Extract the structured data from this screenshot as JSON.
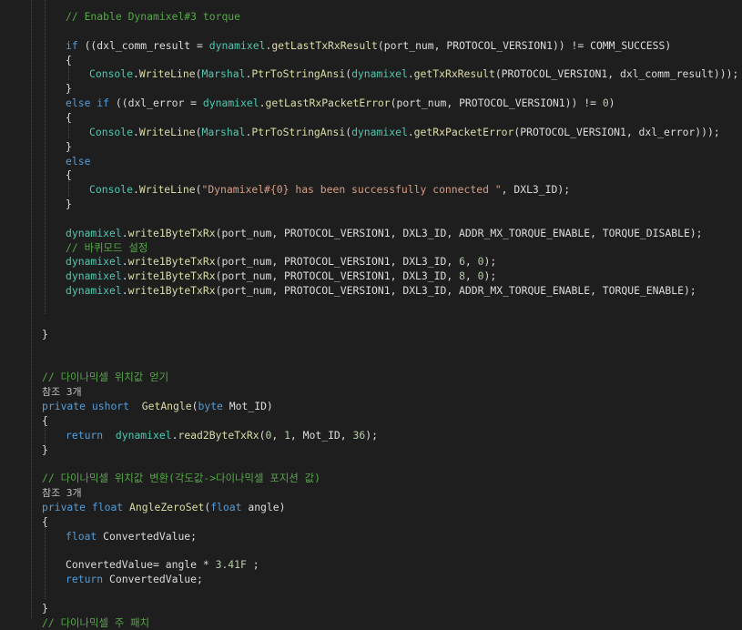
{
  "lines": [
    {
      "indent": 3,
      "tokens": [
        {
          "t": "// Enable Dynamixel#3 torque",
          "c": "comment"
        }
      ]
    },
    {
      "indent": 0,
      "tokens": []
    },
    {
      "indent": 3,
      "tokens": [
        {
          "t": "if",
          "c": "keyword"
        },
        {
          "t": " ((dxl_comm_result = ",
          "c": "plain"
        },
        {
          "t": "dynamixel",
          "c": "type"
        },
        {
          "t": ".",
          "c": "plain"
        },
        {
          "t": "getLastTxRxResult",
          "c": "method"
        },
        {
          "t": "(port_num, PROTOCOL_VERSION1)) != COMM_SUCCESS)",
          "c": "plain"
        }
      ]
    },
    {
      "indent": 3,
      "tokens": [
        {
          "t": "{",
          "c": "plain"
        }
      ]
    },
    {
      "indent": 4,
      "tokens": [
        {
          "t": "Console",
          "c": "type"
        },
        {
          "t": ".",
          "c": "plain"
        },
        {
          "t": "WriteLine",
          "c": "method"
        },
        {
          "t": "(",
          "c": "plain"
        },
        {
          "t": "Marshal",
          "c": "type"
        },
        {
          "t": ".",
          "c": "plain"
        },
        {
          "t": "PtrToStringAnsi",
          "c": "method"
        },
        {
          "t": "(",
          "c": "plain"
        },
        {
          "t": "dynamixel",
          "c": "type"
        },
        {
          "t": ".",
          "c": "plain"
        },
        {
          "t": "getTxRxResult",
          "c": "method"
        },
        {
          "t": "(PROTOCOL_VERSION1, dxl_comm_result)));",
          "c": "plain"
        }
      ]
    },
    {
      "indent": 3,
      "tokens": [
        {
          "t": "}",
          "c": "plain"
        }
      ]
    },
    {
      "indent": 3,
      "tokens": [
        {
          "t": "else if",
          "c": "keyword"
        },
        {
          "t": " ((dxl_error = ",
          "c": "plain"
        },
        {
          "t": "dynamixel",
          "c": "type"
        },
        {
          "t": ".",
          "c": "plain"
        },
        {
          "t": "getLastRxPacketError",
          "c": "method"
        },
        {
          "t": "(port_num, PROTOCOL_VERSION1)) != ",
          "c": "plain"
        },
        {
          "t": "0",
          "c": "number"
        },
        {
          "t": ")",
          "c": "plain"
        }
      ]
    },
    {
      "indent": 3,
      "tokens": [
        {
          "t": "{",
          "c": "plain"
        }
      ]
    },
    {
      "indent": 4,
      "tokens": [
        {
          "t": "Console",
          "c": "type"
        },
        {
          "t": ".",
          "c": "plain"
        },
        {
          "t": "WriteLine",
          "c": "method"
        },
        {
          "t": "(",
          "c": "plain"
        },
        {
          "t": "Marshal",
          "c": "type"
        },
        {
          "t": ".",
          "c": "plain"
        },
        {
          "t": "PtrToStringAnsi",
          "c": "method"
        },
        {
          "t": "(",
          "c": "plain"
        },
        {
          "t": "dynamixel",
          "c": "type"
        },
        {
          "t": ".",
          "c": "plain"
        },
        {
          "t": "getRxPacketError",
          "c": "method"
        },
        {
          "t": "(PROTOCOL_VERSION1, dxl_error)));",
          "c": "plain"
        }
      ]
    },
    {
      "indent": 3,
      "tokens": [
        {
          "t": "}",
          "c": "plain"
        }
      ]
    },
    {
      "indent": 3,
      "tokens": [
        {
          "t": "else",
          "c": "keyword"
        }
      ]
    },
    {
      "indent": 3,
      "tokens": [
        {
          "t": "{",
          "c": "plain"
        }
      ]
    },
    {
      "indent": 4,
      "tokens": [
        {
          "t": "Console",
          "c": "type"
        },
        {
          "t": ".",
          "c": "plain"
        },
        {
          "t": "WriteLine",
          "c": "method"
        },
        {
          "t": "(",
          "c": "plain"
        },
        {
          "t": "\"Dynamixel#{0} has been successfully connected \"",
          "c": "string"
        },
        {
          "t": ", DXL3_ID);",
          "c": "plain"
        }
      ]
    },
    {
      "indent": 3,
      "tokens": [
        {
          "t": "}",
          "c": "plain"
        }
      ]
    },
    {
      "indent": 0,
      "tokens": []
    },
    {
      "indent": 3,
      "tokens": [
        {
          "t": "dynamixel",
          "c": "type"
        },
        {
          "t": ".",
          "c": "plain"
        },
        {
          "t": "write1ByteTxRx",
          "c": "method"
        },
        {
          "t": "(port_num, PROTOCOL_VERSION1, DXL3_ID, ADDR_MX_TORQUE_ENABLE, TORQUE_DISABLE);",
          "c": "plain"
        }
      ]
    },
    {
      "indent": 3,
      "tokens": [
        {
          "t": "// 바퀴모드 설정",
          "c": "comment"
        }
      ]
    },
    {
      "indent": 3,
      "tokens": [
        {
          "t": "dynamixel",
          "c": "type"
        },
        {
          "t": ".",
          "c": "plain"
        },
        {
          "t": "write1ByteTxRx",
          "c": "method"
        },
        {
          "t": "(port_num, PROTOCOL_VERSION1, DXL3_ID, ",
          "c": "plain"
        },
        {
          "t": "6",
          "c": "number"
        },
        {
          "t": ", ",
          "c": "plain"
        },
        {
          "t": "0",
          "c": "number"
        },
        {
          "t": ");",
          "c": "plain"
        }
      ]
    },
    {
      "indent": 3,
      "tokens": [
        {
          "t": "dynamixel",
          "c": "type"
        },
        {
          "t": ".",
          "c": "plain"
        },
        {
          "t": "write1ByteTxRx",
          "c": "method"
        },
        {
          "t": "(port_num, PROTOCOL_VERSION1, DXL3_ID, ",
          "c": "plain"
        },
        {
          "t": "8",
          "c": "number"
        },
        {
          "t": ", ",
          "c": "plain"
        },
        {
          "t": "0",
          "c": "number"
        },
        {
          "t": ");",
          "c": "plain"
        }
      ]
    },
    {
      "indent": 3,
      "tokens": [
        {
          "t": "dynamixel",
          "c": "type"
        },
        {
          "t": ".",
          "c": "plain"
        },
        {
          "t": "write1ByteTxRx",
          "c": "method"
        },
        {
          "t": "(port_num, PROTOCOL_VERSION1, DXL3_ID, ADDR_MX_TORQUE_ENABLE, TORQUE_ENABLE);",
          "c": "plain"
        }
      ]
    },
    {
      "indent": 0,
      "tokens": []
    },
    {
      "indent": 0,
      "tokens": []
    },
    {
      "indent": 2,
      "tokens": [
        {
          "t": "}",
          "c": "plain"
        }
      ]
    },
    {
      "indent": 0,
      "tokens": []
    },
    {
      "indent": 0,
      "tokens": []
    },
    {
      "indent": 2,
      "tokens": [
        {
          "t": "// 다이나믹셀 위치값 얻기",
          "c": "comment"
        }
      ]
    },
    {
      "indent": 2,
      "tokens": [
        {
          "t": "참조 3개",
          "c": "codelens"
        }
      ]
    },
    {
      "indent": 2,
      "tokens": [
        {
          "t": "private",
          "c": "keyword"
        },
        {
          "t": " ",
          "c": "plain"
        },
        {
          "t": "ushort",
          "c": "keyword"
        },
        {
          "t": "  ",
          "c": "plain"
        },
        {
          "t": "GetAngle",
          "c": "method"
        },
        {
          "t": "(",
          "c": "plain"
        },
        {
          "t": "byte",
          "c": "keyword"
        },
        {
          "t": " Mot_ID)",
          "c": "plain"
        }
      ]
    },
    {
      "indent": 2,
      "tokens": [
        {
          "t": "{",
          "c": "plain"
        }
      ]
    },
    {
      "indent": 3,
      "tokens": [
        {
          "t": "return",
          "c": "keyword"
        },
        {
          "t": "  ",
          "c": "plain"
        },
        {
          "t": "dynamixel",
          "c": "type"
        },
        {
          "t": ".",
          "c": "plain"
        },
        {
          "t": "read2ByteTxRx",
          "c": "method"
        },
        {
          "t": "(",
          "c": "plain"
        },
        {
          "t": "0",
          "c": "number"
        },
        {
          "t": ", ",
          "c": "plain"
        },
        {
          "t": "1",
          "c": "number"
        },
        {
          "t": ", Mot_ID, ",
          "c": "plain"
        },
        {
          "t": "36",
          "c": "number"
        },
        {
          "t": ");",
          "c": "plain"
        }
      ]
    },
    {
      "indent": 2,
      "tokens": [
        {
          "t": "}",
          "c": "plain"
        }
      ]
    },
    {
      "indent": 0,
      "tokens": []
    },
    {
      "indent": 2,
      "tokens": [
        {
          "t": "// 다이나믹셀 위치값 변환(각도값->다이나믹셀 포지션 값)",
          "c": "comment"
        }
      ]
    },
    {
      "indent": 2,
      "tokens": [
        {
          "t": "참조 3개",
          "c": "codelens"
        }
      ]
    },
    {
      "indent": 2,
      "tokens": [
        {
          "t": "private",
          "c": "keyword"
        },
        {
          "t": " ",
          "c": "plain"
        },
        {
          "t": "float",
          "c": "keyword"
        },
        {
          "t": " ",
          "c": "plain"
        },
        {
          "t": "AngleZeroSet",
          "c": "method"
        },
        {
          "t": "(",
          "c": "plain"
        },
        {
          "t": "float",
          "c": "keyword"
        },
        {
          "t": " angle)",
          "c": "plain"
        }
      ]
    },
    {
      "indent": 2,
      "tokens": [
        {
          "t": "{",
          "c": "plain"
        }
      ]
    },
    {
      "indent": 3,
      "tokens": [
        {
          "t": "float",
          "c": "keyword"
        },
        {
          "t": " ConvertedValue;",
          "c": "plain"
        }
      ]
    },
    {
      "indent": 0,
      "tokens": []
    },
    {
      "indent": 3,
      "tokens": [
        {
          "t": "ConvertedValue= angle * ",
          "c": "plain"
        },
        {
          "t": "3.41F",
          "c": "number"
        },
        {
          "t": " ;",
          "c": "plain"
        }
      ]
    },
    {
      "indent": 3,
      "tokens": [
        {
          "t": "return",
          "c": "keyword"
        },
        {
          "t": " ConvertedValue;",
          "c": "plain"
        }
      ]
    },
    {
      "indent": 0,
      "tokens": []
    },
    {
      "indent": 2,
      "tokens": [
        {
          "t": "}",
          "c": "plain"
        }
      ]
    },
    {
      "indent": 2,
      "tokens": [
        {
          "t": "// 다이나믹셀 주 패치",
          "c": "comment"
        }
      ]
    }
  ]
}
